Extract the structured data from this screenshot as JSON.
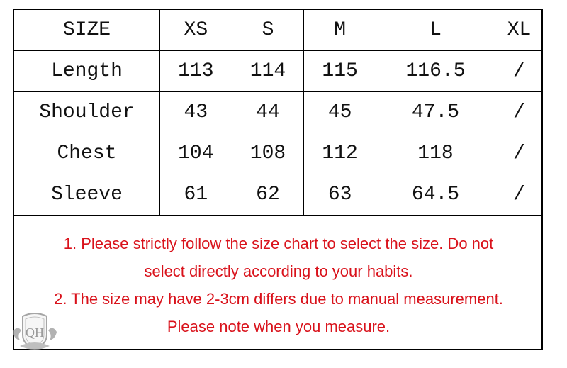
{
  "table": {
    "header": [
      "SIZE",
      "XS",
      "S",
      "M",
      "L",
      "XL"
    ],
    "rows": [
      [
        "Length",
        "113",
        "114",
        "115",
        "116.5",
        "/"
      ],
      [
        "Shoulder",
        "43",
        "44",
        "45",
        "47.5",
        "/"
      ],
      [
        "Chest",
        "104",
        "108",
        "112",
        "118",
        "/"
      ],
      [
        "Sleeve",
        "61",
        "62",
        "63",
        "64.5",
        "/"
      ]
    ]
  },
  "notes": [
    "1. Please strictly follow the size chart  to select the size. Do not",
    "select directly according to your habits.",
    "2. The size may have 2-3cm differs due to manual measurement.",
    "Please note when you measure."
  ],
  "logo": {
    "text": "QH"
  },
  "colors": {
    "note_text": "#d9121b",
    "border": "#000000"
  }
}
